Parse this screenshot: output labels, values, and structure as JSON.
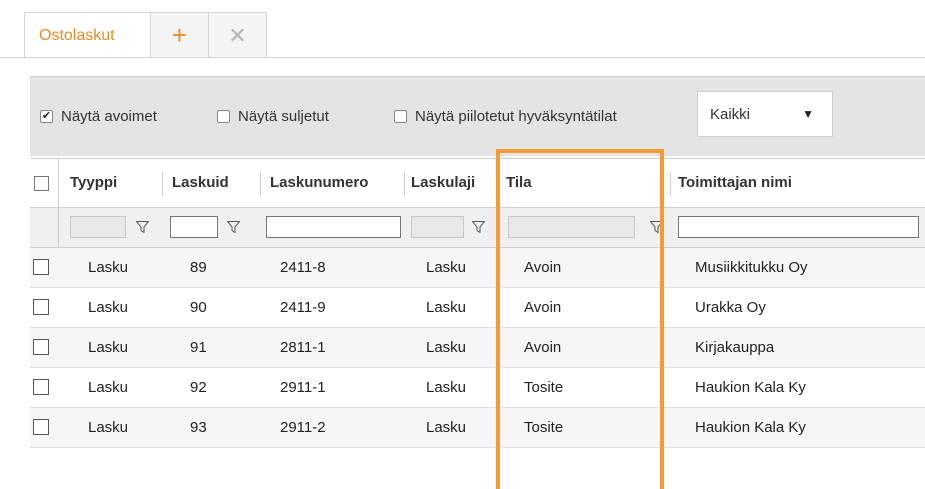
{
  "tabs": {
    "active_label": "Ostolaskut",
    "add_icon_glyph": "+",
    "close_icon_glyph": "✕"
  },
  "toolbar": {
    "show_open": {
      "label": "Näytä avoimet",
      "checked": true
    },
    "show_closed": {
      "label": "Näytä suljetut",
      "checked": false
    },
    "show_hidden": {
      "label": "Näytä piilotetut hyväksyntätilat",
      "checked": false
    },
    "filter_select": {
      "value": "Kaikki",
      "arrow": "▼"
    }
  },
  "grid": {
    "columns": [
      "Tyyppi",
      "Laskuid",
      "Laskunumero",
      "Laskulaji",
      "Tila",
      "Toimittajan nimi"
    ],
    "rows": [
      {
        "tyyppi": "Lasku",
        "laskuid": "89",
        "laskunumero": "2411-8",
        "laskulaji": "Lasku",
        "tila": "Avoin",
        "toimittaja": "Musiikkitukku Oy"
      },
      {
        "tyyppi": "Lasku",
        "laskuid": "90",
        "laskunumero": "2411-9",
        "laskulaji": "Lasku",
        "tila": "Avoin",
        "toimittaja": "Urakka Oy"
      },
      {
        "tyyppi": "Lasku",
        "laskuid": "91",
        "laskunumero": "2811-1",
        "laskulaji": "Lasku",
        "tila": "Avoin",
        "toimittaja": "Kirjakauppa"
      },
      {
        "tyyppi": "Lasku",
        "laskuid": "92",
        "laskunumero": "2911-1",
        "laskulaji": "Lasku",
        "tila": "Tosite",
        "toimittaja": "Haukion Kala Ky"
      },
      {
        "tyyppi": "Lasku",
        "laskuid": "93",
        "laskunumero": "2911-2",
        "laskulaji": "Lasku",
        "tila": "Tosite",
        "toimittaja": "Haukion Kala Ky"
      }
    ]
  },
  "colors": {
    "accent_orange": "#f08a24",
    "highlight_border": "#f39c35",
    "toolbar_bg": "#e4e4e4"
  }
}
